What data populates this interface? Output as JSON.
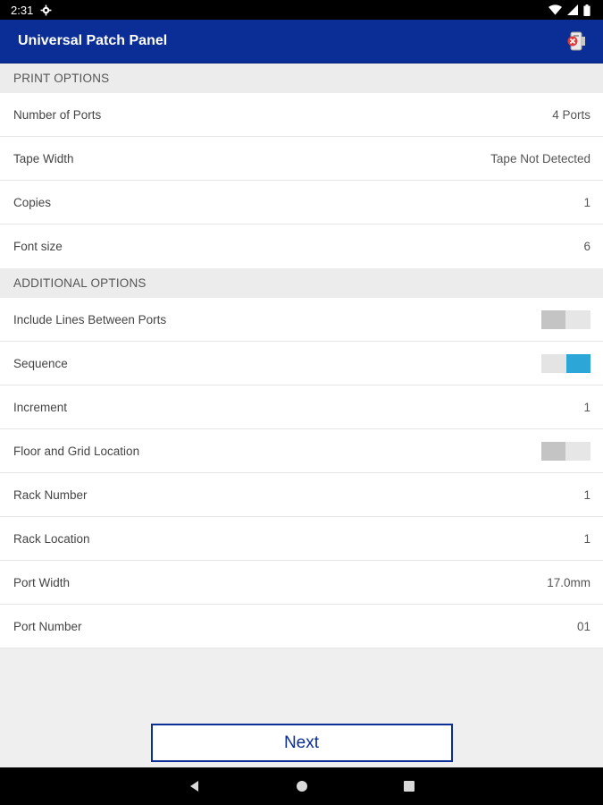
{
  "status_bar": {
    "time": "2:31",
    "icons": [
      "settings-icon",
      "wifi-icon",
      "signal-icon",
      "battery-icon"
    ]
  },
  "app_bar": {
    "title": "Universal Patch Panel",
    "action_icon": "printer-disconnected-icon",
    "color": "#0b2e96"
  },
  "print_options": {
    "header": "PRINT OPTIONS",
    "rows": [
      {
        "label": "Number of Ports",
        "value": "4 Ports"
      },
      {
        "label": "Tape Width",
        "value": "Tape Not Detected"
      },
      {
        "label": "Copies",
        "value": "1"
      },
      {
        "label": "Font size",
        "value": "6"
      }
    ]
  },
  "additional_options": {
    "header": "ADDITIONAL OPTIONS",
    "include_lines": {
      "label": "Include Lines Between Ports",
      "on": false
    },
    "sequence": {
      "label": "Sequence",
      "on": true
    },
    "increment": {
      "label": "Increment",
      "value": "1"
    },
    "floor_grid": {
      "label": "Floor and Grid Location",
      "on": false
    },
    "rack_number": {
      "label": "Rack Number",
      "value": "1"
    },
    "rack_location": {
      "label": "Rack Location",
      "value": "1"
    },
    "port_width": {
      "label": "Port Width",
      "value": "17.0mm"
    },
    "port_number": {
      "label": "Port Number",
      "value": "01"
    }
  },
  "next_button": {
    "label": "Next"
  },
  "nav_bar": {
    "icons": [
      "back-icon",
      "home-icon",
      "recents-icon"
    ]
  },
  "colors": {
    "accent": "#2ba6d6",
    "brand": "#0b2e96"
  }
}
